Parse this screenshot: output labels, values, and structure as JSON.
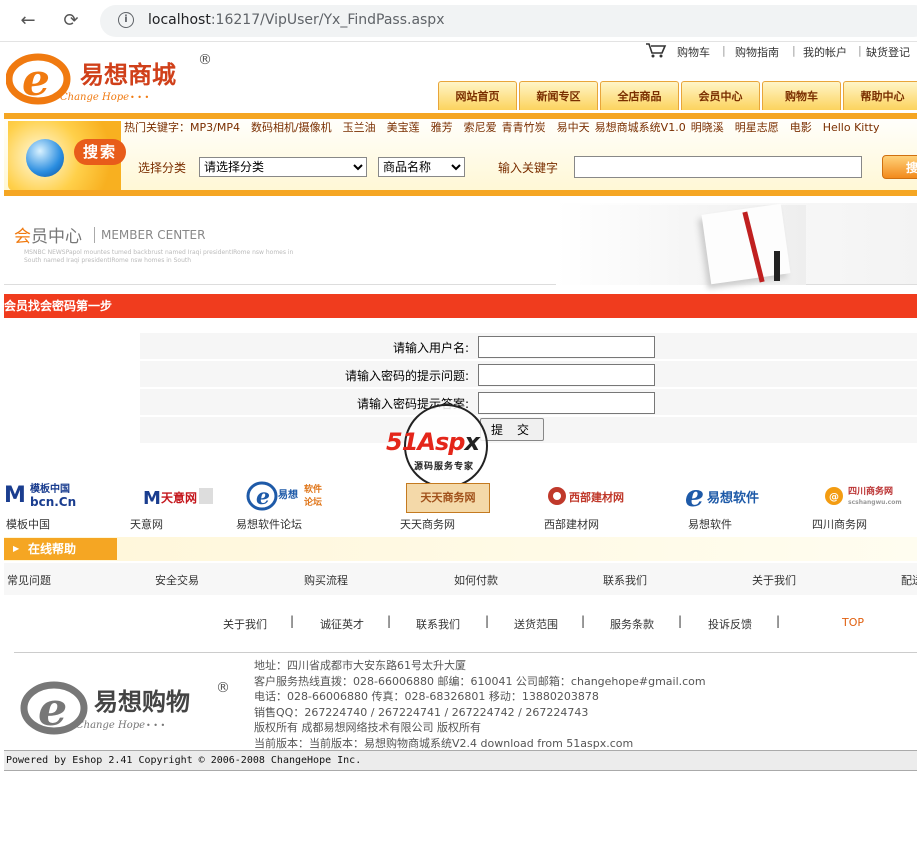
{
  "browser": {
    "url_host": "localhost",
    "url_path": ":16217/VipUser/Yx_FindPass.aspx"
  },
  "top_links": [
    "购物车",
    "|",
    "购物指南",
    "|",
    "我的帐户",
    "|",
    "缺货登记"
  ],
  "logo": {
    "brand_cn": "易想商城",
    "brand_en": "Change Hope",
    "dots": "• • •",
    "reg": "®",
    "mark_letter": "e"
  },
  "nav_tabs": [
    "网站首页",
    "新闻专区",
    "全店商品",
    "会员中心",
    "购物车",
    "帮助中心"
  ],
  "search": {
    "badge": "搜索",
    "hot_label": "热门关键字：",
    "hot_keywords": [
      "MP3/MP4",
      "数码相机/摄像机",
      "玉兰油",
      "美宝莲",
      "雅芳",
      "索尼爱",
      "青青竹炭",
      "易中天",
      "易想商城系统V1.0",
      "明晓溪",
      "明星志愿",
      "电影",
      "Hello Kitty"
    ],
    "category_label": "选择分类",
    "category_value": "请选择分类",
    "field_value": "商品名称",
    "keyword_label": "输入关键字",
    "button": "搜"
  },
  "member_center": {
    "cn_first": "会",
    "cn_rest": "员中心",
    "en": "MEMBER CENTER",
    "small_text": "MSNBC NEWSPapol mountes tumed backbrust named Iraqi presidentIRome nsw homes in South named Iraqi presidentIRome nsw homes in South"
  },
  "step_title": "会员找会密码第一步",
  "form": {
    "username_label": "请输入用户名:",
    "question_label": "请输入密码的提示问题:",
    "answer_label": "请输入密码提示答案:",
    "submit": "提交"
  },
  "watermark": {
    "brand_a": "51Asp",
    "brand_x": "x",
    "sub": "源码服务专家"
  },
  "partners": [
    {
      "name": "模板中国",
      "logo_text": "模板中国 bcn.Cn",
      "color": "#1a3d8f"
    },
    {
      "name": "天意网",
      "logo_text": "天意网",
      "color": "#c4161c"
    },
    {
      "name": "易想软件论坛",
      "logo_text": "易想 软件论坛",
      "color": "#1e5aa8"
    },
    {
      "name": "天天商务网",
      "logo_text": "天天商务网",
      "color": "#c47a20"
    },
    {
      "name": "西部建材网",
      "logo_text": "西部建材网",
      "color": "#c0392b"
    },
    {
      "name": "易想软件",
      "logo_text": "易想软件",
      "color": "#1e5aa8"
    },
    {
      "name": "四川商务网",
      "logo_text": "四川商务网",
      "color": "#b33"
    }
  ],
  "help": {
    "title": "在线帮助",
    "arrow": "▶",
    "links": [
      "常见问题",
      "安全交易",
      "购买流程",
      "如何付款",
      "联系我们",
      "关于我们",
      "配送"
    ]
  },
  "footer_nav": [
    "关于我们",
    "诚征英才",
    "联系我们",
    "送货范围",
    "服务条款",
    "投诉反馈"
  ],
  "footer_sep": "|",
  "footer_top": "TOP",
  "footer_logo": {
    "brand_cn": "易想购物",
    "brand_en": "Change Hope",
    "dots": "• • •",
    "reg": "®",
    "mark_letter": "e"
  },
  "footer_info": {
    "address": "地址：四川省成都市大安东路61号太升大厦",
    "hotline": "客户服务热线直拨：028-66006880 邮编：610041 公司邮箱：changehope#gmail.com",
    "phone": "电话：028-66006880 传真：028-68326801 移动：13880203878",
    "qq": "销售QQ：267224740 / 267224741 / 267224742 / 267224743",
    "copyright": "版权所有 成都易想网络技术有限公司 版权所有",
    "version": "当前版本：当前版本：易想购物商城系统V2.4 download from 51aspx.com"
  },
  "powered": "Powered by Eshop 2.41 Copyright © 2006-2008 ChangeHope Inc."
}
